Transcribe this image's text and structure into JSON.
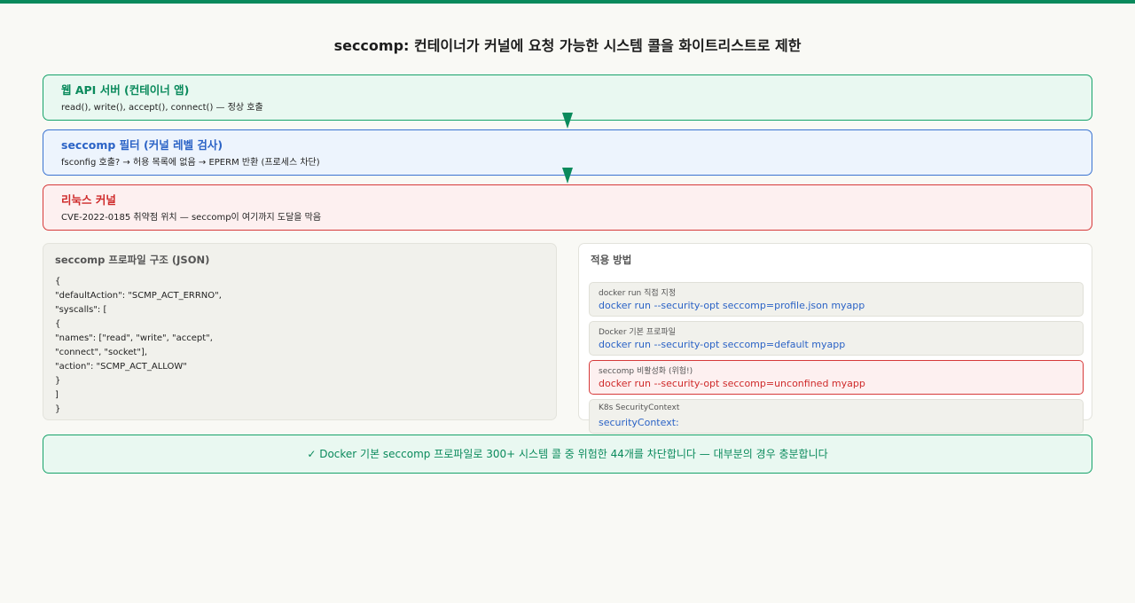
{
  "title": "seccomp: 컨테이너가 커널에 요청 가능한 시스템 콜을 화이트리스트로 제한",
  "colors": {
    "green": "#0a8a5c",
    "blue": "#2b63c6",
    "red": "#cf2a2a"
  },
  "layers": [
    {
      "title": "웹 API 서버 (컨테이너 앱)",
      "desc": "read(), write(), accept(), connect() — 정상 호출"
    },
    {
      "title": "seccomp 필터 (커널 레벨 검사)",
      "desc": "fsconfig 호출? → 허용 목록에 없음 → EPERM 반환 (프로세스 차단)"
    },
    {
      "title": "리눅스 커널",
      "desc": "CVE-2022-0185 취약점 위치 — seccomp이 여기까지 도달을 막음"
    }
  ],
  "profile": {
    "title": "seccomp 프로파일 구조 (JSON)",
    "lines": [
      "{",
      "\"defaultAction\": \"SCMP_ACT_ERRNO\",",
      "\"syscalls\": [",
      "{",
      "\"names\": [\"read\", \"write\", \"accept\",",
      "\"connect\", \"socket\"],",
      "\"action\": \"SCMP_ACT_ALLOW\"",
      "}",
      "]",
      "}"
    ]
  },
  "apply": {
    "title": "적용 방법",
    "options": [
      {
        "label": "docker run 직접 지정",
        "code": "docker run --security-opt seccomp=profile.json myapp"
      },
      {
        "label": "Docker 기본 프로파일",
        "code": "docker run --security-opt seccomp=default myapp"
      },
      {
        "label": "seccomp 비활성화 (위험!)",
        "code": "docker run --security-opt seccomp=unconfined myapp"
      },
      {
        "label": "K8s SecurityContext",
        "code": "securityContext:"
      }
    ]
  },
  "footer": "✓ Docker 기본 seccomp 프로파일로 300+ 시스템 콜 중 위험한 44개를 차단합니다 — 대부분의 경우 충분합니다"
}
